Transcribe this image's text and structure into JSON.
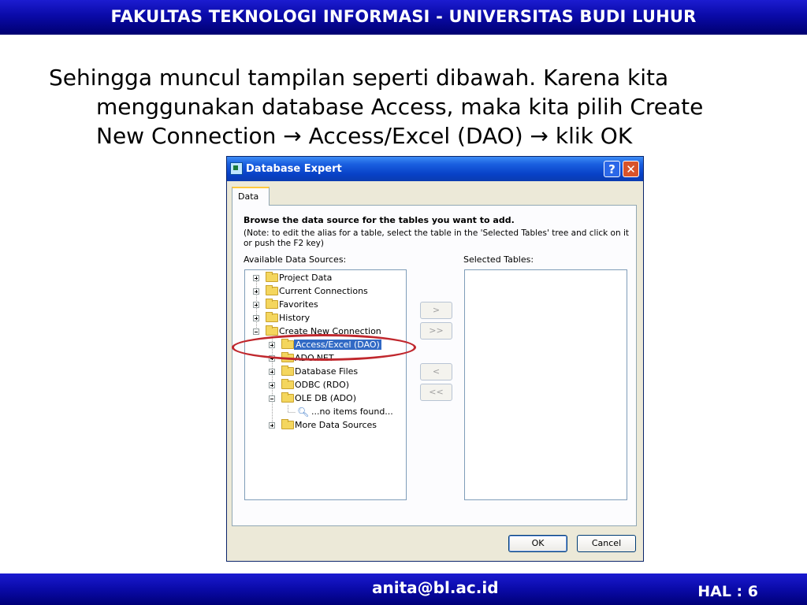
{
  "header": {
    "title": "FAKULTAS TEKNOLOGI INFORMASI - UNIVERSITAS BUDI LUHUR"
  },
  "body": {
    "line1": "Sehingga muncul tampilan seperti dibawah. Karena kita",
    "line2": "menggunakan database Access, maka kita pilih Create",
    "line3": "New Connection → Access/Excel (DAO) → klik OK"
  },
  "dialog": {
    "title": "Database Expert",
    "help_label": "?",
    "close_label": "✕",
    "tab_label": "Data",
    "heading": "Browse the data source for the tables you want to add.",
    "note": "(Note: to edit the alias for a table, select the table in the 'Selected Tables' tree and click on it or push the F2 key)",
    "available_label": "Available Data Sources:",
    "selected_label": "Selected Tables:",
    "tree": [
      {
        "label": "Project Data",
        "toggle": "plus"
      },
      {
        "label": "Current Connections",
        "toggle": "plus"
      },
      {
        "label": "Favorites",
        "toggle": "plus"
      },
      {
        "label": "History",
        "toggle": "plus"
      },
      {
        "label": "Create New Connection",
        "toggle": "minus"
      },
      {
        "label": "Access/Excel (DAO)",
        "toggle": "plus",
        "selected": true
      },
      {
        "label": "ADO.NET",
        "toggle": "plus"
      },
      {
        "label": "Database Files",
        "toggle": "plus"
      },
      {
        "label": "ODBC (RDO)",
        "toggle": "plus"
      },
      {
        "label": "OLE DB (ADO)",
        "toggle": "minus"
      },
      {
        "label": "...no items found...",
        "toggle": "none"
      },
      {
        "label": "More Data Sources",
        "toggle": "plus"
      }
    ],
    "buttons": {
      "add": ">",
      "add_all": ">>",
      "remove": "<",
      "remove_all": "<<",
      "ok": "OK",
      "cancel": "Cancel"
    }
  },
  "footer": {
    "email": "anita@bl.ac.id",
    "page": "HAL : 6"
  },
  "colors": {
    "bar": "#0a0aa8",
    "highlight": "#c0272d",
    "selection": "#316ac5"
  }
}
